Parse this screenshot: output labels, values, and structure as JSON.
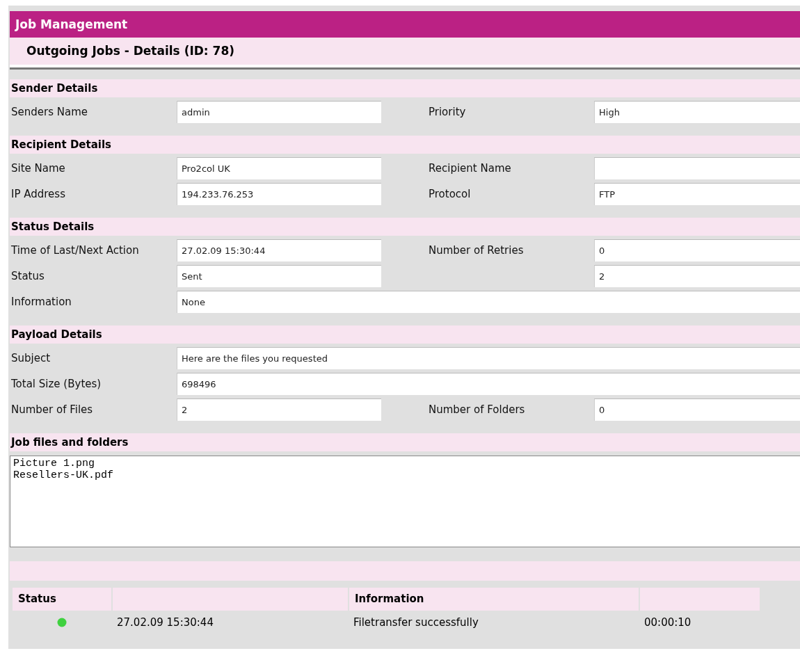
{
  "title": "Job Management",
  "subtitle": "Outgoing Jobs - Details (ID: 78)",
  "sections": [
    {
      "title": "Sender Details",
      "rows": [
        [
          {
            "label": "Senders Name",
            "value": "admin"
          },
          {
            "label": "Priority",
            "value": "High"
          }
        ]
      ]
    },
    {
      "title": "Recipient Details",
      "rows": [
        [
          {
            "label": "Site Name",
            "value": "Pro2col UK"
          },
          {
            "label": "Recipient Name"
          }
        ],
        [
          {
            "label": "IP Address",
            "value": "194.233.76.253"
          },
          {
            "label": "Protocol",
            "value": "FTP"
          }
        ]
      ]
    },
    {
      "title": "Status Details",
      "rows": [
        [
          {
            "label": "Time of Last/Next Action",
            "value": "27.02.09 15:30:44"
          },
          {
            "label": "Number of Retries",
            "value": "0"
          }
        ],
        [
          {
            "label": "Status",
            "value": "Sent"
          },
          {
            "value": "2"
          }
        ],
        [
          {
            "label": "Information",
            "value": "None"
          }
        ]
      ]
    },
    {
      "title": "Payload Details",
      "rows": [
        [
          {
            "label": "Subject",
            "value": "Here are the files you requested"
          }
        ],
        [
          {
            "label": "Total Size (Bytes)",
            "value": "698496"
          }
        ],
        [
          {
            "label": "Number of Files",
            "value": "2"
          },
          {
            "label": "Number of Folders",
            "value": "0"
          }
        ]
      ]
    }
  ],
  "files": {
    "title": "Job files and folders",
    "items": [
      "Picture 1.png",
      "Resellers-UK.pdf"
    ]
  },
  "log": {
    "columns": [
      "Status",
      "",
      "Information",
      ""
    ],
    "rows": [
      {
        "cells": [
          {
            "color": "#3fd13f"
          },
          "27.02.09 15:30:44",
          "Filetransfer successfully",
          "00:00:10"
        ]
      }
    ]
  }
}
